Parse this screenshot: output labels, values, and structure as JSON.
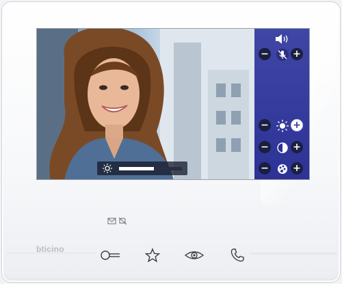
{
  "device": {
    "brand": "bticino",
    "colors": {
      "panel": "#2d3296",
      "button_dark": "#1b1f3f",
      "button_light": "#ffffff"
    }
  },
  "video_overlay": {
    "brightness_icon": "sun-icon",
    "brightness_level": 0.55
  },
  "side_panel": {
    "header_icon": "speaker-icon",
    "rows": [
      {
        "name": "volume",
        "minus": "−",
        "plus": "+",
        "icon": "mic-mute-icon"
      },
      {
        "name": "brightness",
        "minus": "−",
        "plus": "+",
        "icon": "sun-icon",
        "plus_highlight": true
      },
      {
        "name": "contrast",
        "minus": "−",
        "plus": "+",
        "icon": "contrast-icon"
      },
      {
        "name": "color",
        "minus": "−",
        "plus": "+",
        "icon": "palette-icon"
      }
    ]
  },
  "status_icons": [
    "mail-icon",
    "no-disturb-icon"
  ],
  "softkeys": [
    "key-icon",
    "star-icon",
    "eye-icon",
    "phone-icon"
  ]
}
